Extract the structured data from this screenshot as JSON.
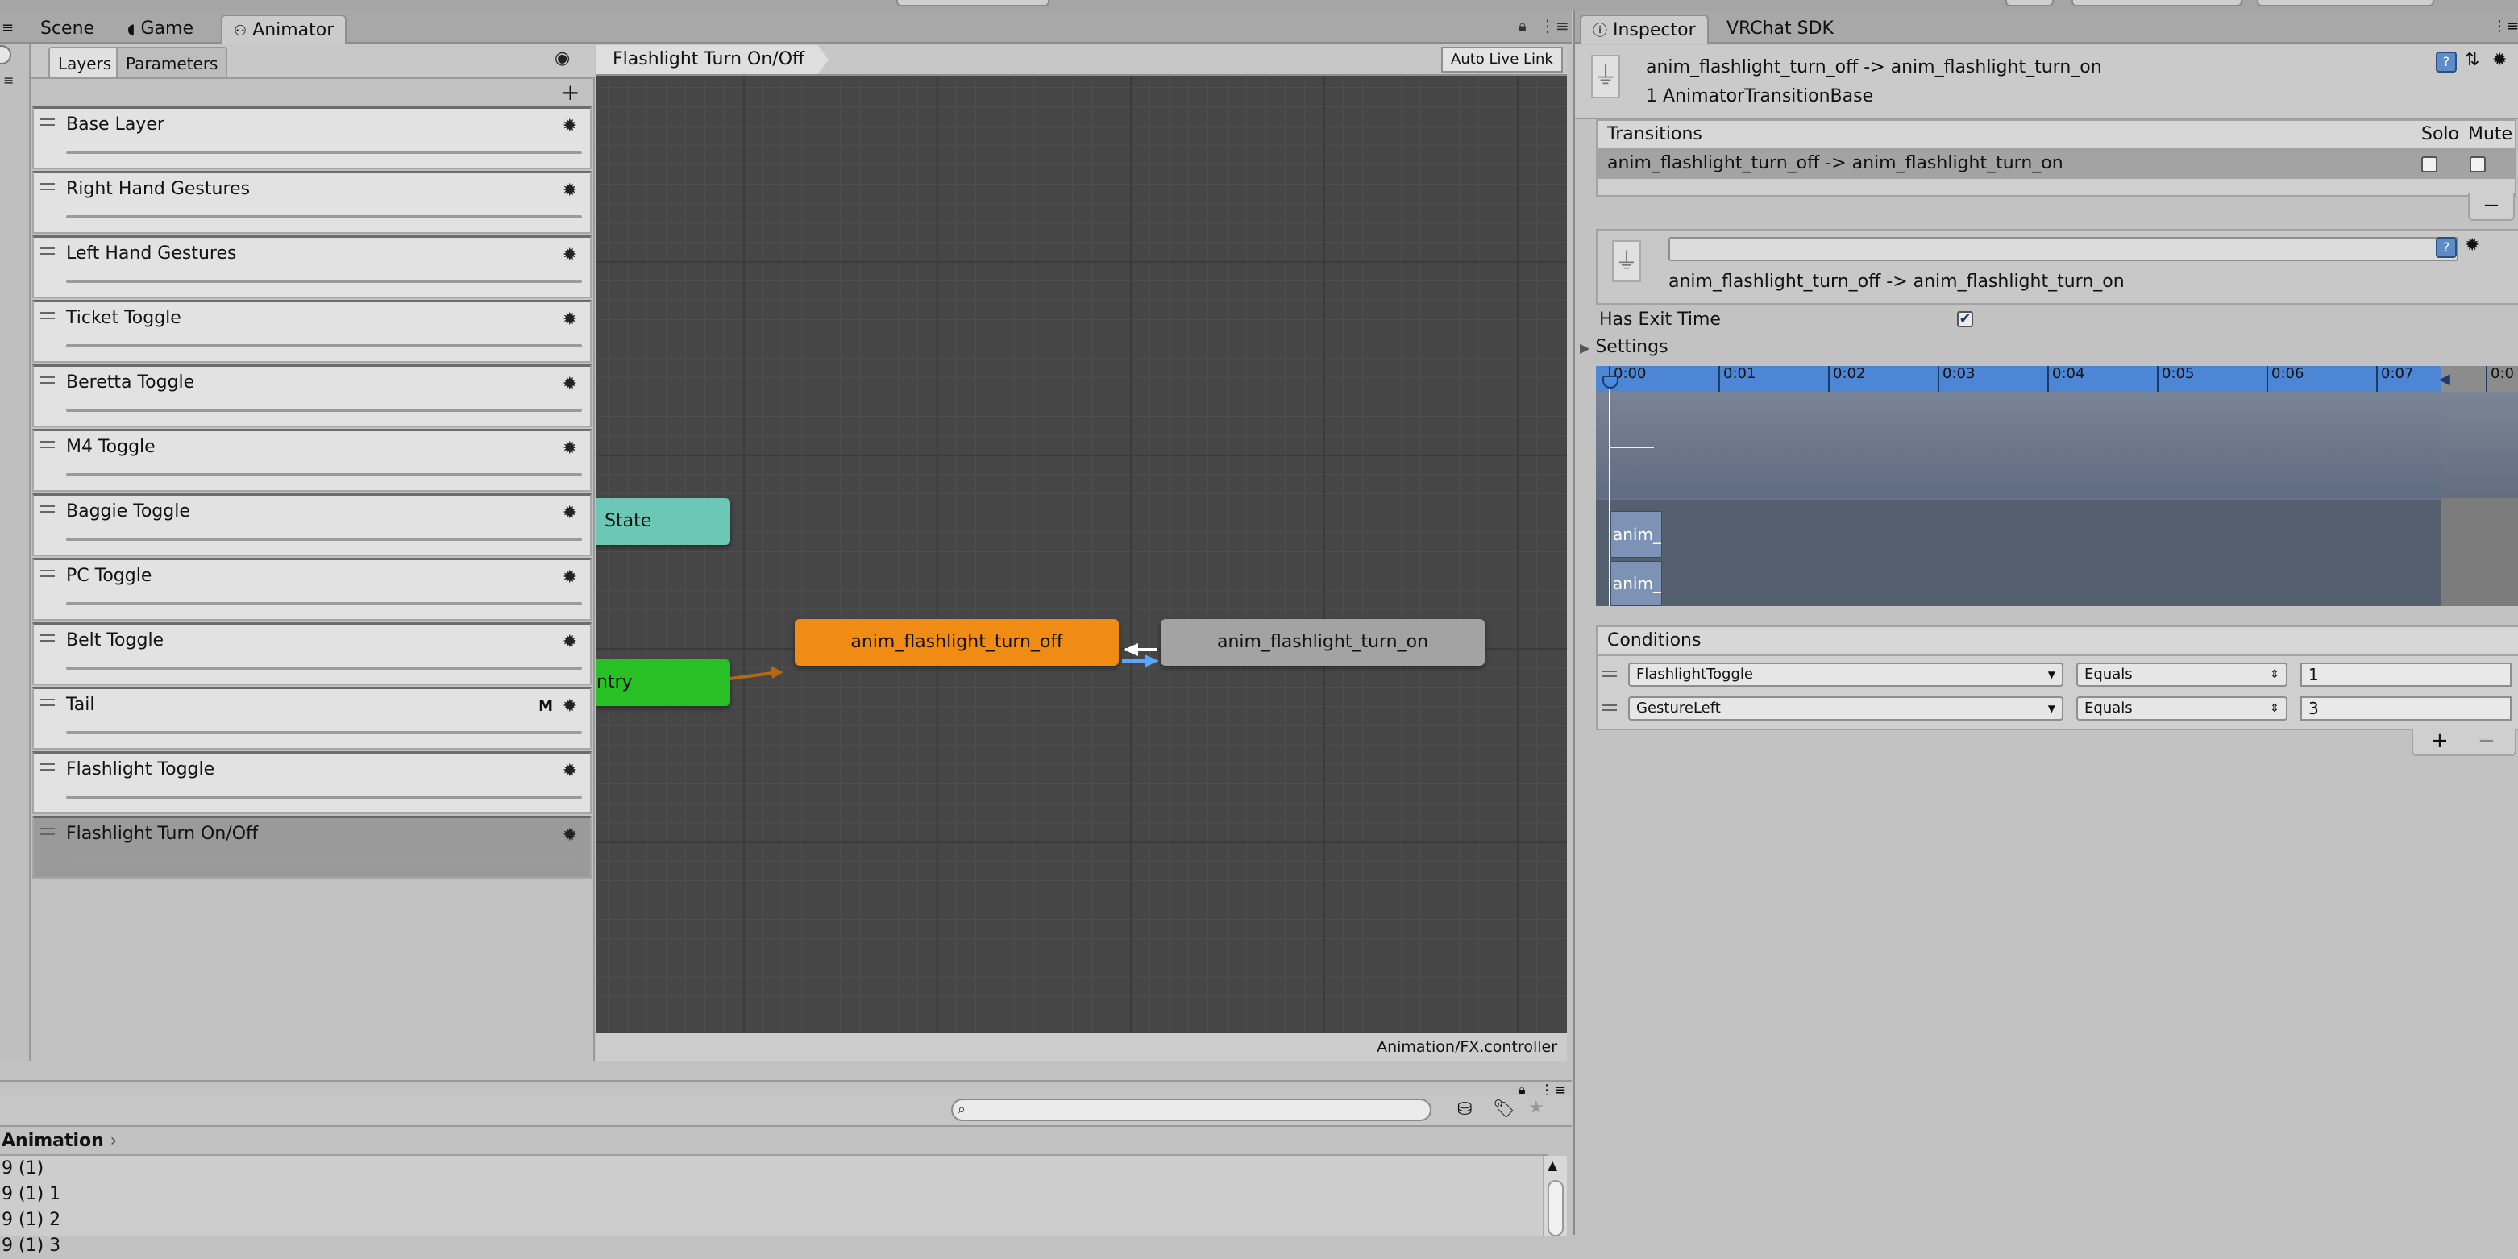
{
  "windowTabs": {
    "scene": "Scene",
    "game": "Game",
    "animator": "Animator"
  },
  "layersPanel": {
    "tabs": {
      "layers": "Layers",
      "parameters": "Parameters"
    },
    "add": "+",
    "eye": "◉",
    "layers": [
      {
        "name": "Base Layer"
      },
      {
        "name": "Right Hand Gestures"
      },
      {
        "name": "Left Hand Gestures"
      },
      {
        "name": "Ticket Toggle"
      },
      {
        "name": "Beretta Toggle"
      },
      {
        "name": "M4 Toggle"
      },
      {
        "name": "Baggie Toggle"
      },
      {
        "name": "PC Toggle"
      },
      {
        "name": "Belt Toggle"
      },
      {
        "name": "Tail",
        "badge": "M"
      },
      {
        "name": "Flashlight Toggle"
      },
      {
        "name": "Flashlight Turn On/Off",
        "selected": true
      }
    ],
    "gear": "✹"
  },
  "graph": {
    "breadcrumb": "Flashlight Turn On/Off",
    "autoLiveLink": "Auto Live Link",
    "nodes": {
      "anyState": "State",
      "entry": "ntry",
      "off": "anim_flashlight_turn_off",
      "on": "anim_flashlight_turn_on"
    },
    "footer": "Animation/FX.controller",
    "colors": {
      "anyState": "#6cc7b6",
      "entry": "#29c026",
      "off": "#f08c14",
      "on": "#a3a3a3",
      "background": "#464646"
    }
  },
  "bottomPanel": {
    "breadcrumb": "Animation",
    "items": [
      "9 (1)",
      "9 (1) 1",
      "9 (1) 2",
      "9 (1) 3"
    ]
  },
  "inspector": {
    "tabs": {
      "inspector": "Inspector",
      "vrchat": "VRChat SDK"
    },
    "header": {
      "title": "anim_flashlight_turn_off -> anim_flashlight_turn_on",
      "subtitle": "1 AnimatorTransitionBase"
    },
    "transitions": {
      "header": "Transitions",
      "solo": "Solo",
      "mute": "Mute",
      "row": "anim_flashlight_turn_off -> anim_flashlight_turn_on",
      "remove": "−"
    },
    "transition": {
      "name": "anim_flashlight_turn_off -> anim_flashlight_turn_on",
      "hasExitTime": "Has Exit Time",
      "hasExitTimeChecked": true,
      "settings": "Settings"
    },
    "timeline": {
      "ticks": [
        "0:00",
        "0:01",
        "0:02",
        "0:03",
        "0:04",
        "0:05",
        "0:06",
        "0:07",
        "0:0"
      ],
      "clipA": "anim_",
      "clipB": "anim_"
    },
    "conditions": {
      "header": "Conditions",
      "rows": [
        {
          "param": "FlashlightToggle",
          "op": "Equals",
          "value": "1"
        },
        {
          "param": "GestureLeft",
          "op": "Equals",
          "value": "3"
        }
      ],
      "add": "+",
      "remove": "−"
    }
  }
}
